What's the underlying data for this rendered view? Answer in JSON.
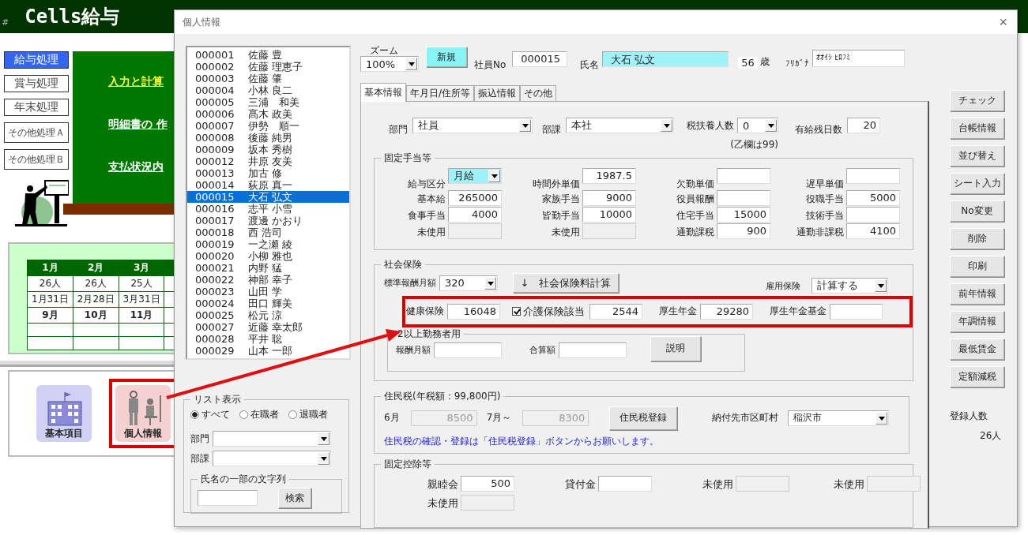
{
  "background_app": {
    "title": "Cells給与",
    "corner_mark": "#",
    "menu": [
      {
        "label": "給与処理",
        "selected": true
      },
      {
        "label": "賞与処理",
        "selected": false
      },
      {
        "label": "年末処理",
        "selected": false
      },
      {
        "label": "その他処理Ａ",
        "selected": false
      },
      {
        "label": "その他処理Ｂ",
        "selected": false
      }
    ],
    "links": [
      {
        "label": "入力と計算",
        "highlighted": true
      },
      {
        "label": "明細書の 作",
        "highlighted": false
      },
      {
        "label": "支払状況内",
        "highlighted": false
      }
    ],
    "calendar": {
      "headers": [
        "1月",
        "2月",
        "3月"
      ],
      "rows": [
        {
          "kind": "count",
          "cells": [
            "26人",
            "26人",
            "25人"
          ]
        },
        {
          "kind": "date",
          "cells": [
            "1月31日",
            "2月28日",
            "3月31日"
          ]
        },
        {
          "kind": "month",
          "cells": [
            "9月",
            "10月",
            "11月"
          ]
        }
      ]
    },
    "icons": [
      {
        "label": "基本項目",
        "kind": "building",
        "highlighted": false
      },
      {
        "label": "個人情報",
        "kind": "people",
        "highlighted": true
      }
    ]
  },
  "dialog": {
    "title": "個人情報",
    "close": "×",
    "employees": [
      {
        "id": "000001",
        "name": "佐藤 豊",
        "selected": false
      },
      {
        "id": "000002",
        "name": "佐藤 理恵子",
        "selected": false
      },
      {
        "id": "000003",
        "name": "佐藤 肇",
        "selected": false
      },
      {
        "id": "000004",
        "name": "小林 良二",
        "selected": false
      },
      {
        "id": "000005",
        "name": "三浦　和美",
        "selected": false
      },
      {
        "id": "000006",
        "name": "髙木 政美",
        "selected": false
      },
      {
        "id": "000007",
        "name": "伊勢　順一",
        "selected": false
      },
      {
        "id": "000008",
        "name": "後藤 純男",
        "selected": false
      },
      {
        "id": "000009",
        "name": "坂本 秀樹",
        "selected": false
      },
      {
        "id": "000012",
        "name": "井原 友美",
        "selected": false
      },
      {
        "id": "000013",
        "name": "加古 修",
        "selected": false
      },
      {
        "id": "000014",
        "name": "荻原 真一",
        "selected": false
      },
      {
        "id": "000015",
        "name": "大石 弘文",
        "selected": true
      },
      {
        "id": "000016",
        "name": "志平 小雪",
        "selected": false
      },
      {
        "id": "000017",
        "name": "渡邊 かおり",
        "selected": false
      },
      {
        "id": "000018",
        "name": "西 浩司",
        "selected": false
      },
      {
        "id": "000019",
        "name": "一之瀬 綾",
        "selected": false
      },
      {
        "id": "000020",
        "name": "小柳 雅也",
        "selected": false
      },
      {
        "id": "000021",
        "name": "内野 猛",
        "selected": false
      },
      {
        "id": "000022",
        "name": "神部 幸子",
        "selected": false
      },
      {
        "id": "000023",
        "name": "山田 学",
        "selected": false
      },
      {
        "id": "000024",
        "name": "田口 輝美",
        "selected": false
      },
      {
        "id": "000025",
        "name": "松元 涼",
        "selected": false
      },
      {
        "id": "000027",
        "name": "近藤 幸太郎",
        "selected": false
      },
      {
        "id": "000028",
        "name": "平井 聡",
        "selected": false
      },
      {
        "id": "000029",
        "name": "山本 一郎",
        "selected": false
      }
    ],
    "list_filter": {
      "title": "リスト表示",
      "options": [
        {
          "label": "すべて",
          "selected": true
        },
        {
          "label": "在職者",
          "selected": false
        },
        {
          "label": "退職者",
          "selected": false
        }
      ],
      "combos": [
        {
          "label": "部門"
        },
        {
          "label": "部課"
        }
      ],
      "search": {
        "title": "氏名の一部の文字列",
        "button": "検索"
      }
    },
    "zoom": {
      "label": "ズーム",
      "value": "100%"
    },
    "new_button": "新規",
    "employee_no": {
      "label": "社員No",
      "value": "000015"
    },
    "name": {
      "label": "氏名",
      "value": "大石 弘文"
    },
    "age": {
      "value": "56",
      "unit": "歳"
    },
    "kana": {
      "label": "ﾌﾘｶﾞﾅ",
      "value": "ｵｵｲｼ ﾋﾛﾌﾐ"
    },
    "tabs": [
      {
        "label": "基本情報",
        "selected": true
      },
      {
        "label": "年月日/住所等",
        "selected": false
      },
      {
        "label": "振込情報",
        "selected": false
      },
      {
        "label": "その他",
        "selected": false
      }
    ],
    "basic": {
      "department": {
        "label": "部門",
        "value": "社員"
      },
      "section": {
        "label": "部課",
        "value": "本社"
      },
      "dependents": {
        "label": "税扶養人数",
        "value": "0",
        "note": "(乙欄は99)"
      },
      "paid_leave": {
        "label": "有給残日数",
        "value": "20"
      },
      "allowances": {
        "title": "固定手当等",
        "items": [
          {
            "label": "給与区分",
            "kind": "combo",
            "value": "月給",
            "disabled": false,
            "highlighted": true
          },
          {
            "label": "時間外単価",
            "kind": "field",
            "value": "1987.5",
            "disabled": false,
            "highlighted": false
          },
          {
            "label": "欠勤単価",
            "kind": "field",
            "disabled": false,
            "highlighted": false
          },
          {
            "label": "遅早単価",
            "kind": "field",
            "disabled": false,
            "highlighted": false
          },
          {
            "label": "基本給",
            "kind": "field",
            "value": "265000",
            "disabled": false,
            "highlighted": false
          },
          {
            "label": "家族手当",
            "kind": "field",
            "value": "9000",
            "disabled": false,
            "highlighted": false
          },
          {
            "label": "役員報酬",
            "kind": "field",
            "disabled": false,
            "highlighted": false
          },
          {
            "label": "役職手当",
            "kind": "field",
            "value": "5000",
            "disabled": false,
            "highlighted": false
          },
          {
            "label": "食事手当",
            "kind": "field",
            "value": "4000",
            "disabled": false,
            "highlighted": false
          },
          {
            "label": "皆勤手当",
            "kind": "field",
            "value": "10000",
            "disabled": false,
            "highlighted": false
          },
          {
            "label": "住宅手当",
            "kind": "field",
            "value": "15000",
            "disabled": false,
            "highlighted": false
          },
          {
            "label": "技術手当",
            "kind": "field",
            "disabled": false,
            "highlighted": false
          },
          {
            "label": "未使用",
            "kind": "field",
            "disabled": true,
            "highlighted": false
          },
          {
            "label": "未使用",
            "kind": "field",
            "disabled": true,
            "highlighted": false
          },
          {
            "label": "通勤課税",
            "kind": "field",
            "value": "900",
            "disabled": false,
            "highlighted": false
          },
          {
            "label": "通勤非課税",
            "kind": "field",
            "value": "4100",
            "disabled": false,
            "highlighted": false
          }
        ]
      },
      "social": {
        "title": "社会保険",
        "standard": {
          "label": "標準報酬月額",
          "value": "320"
        },
        "calc_button": "↓　社会保険料計算",
        "employment": {
          "label": "雇用保険",
          "value": "計算する"
        },
        "premiums": {
          "highlighted": true,
          "items": [
            {
              "label": "健康保険",
              "kind": "field",
              "value": "16048"
            },
            {
              "label": "介護保険該当",
              "kind": "check",
              "checked": true,
              "value": "2544"
            },
            {
              "label": "厚生年金",
              "kind": "field",
              "value": "29280"
            },
            {
              "label": "厚生年金基金",
              "kind": "field"
            }
          ]
        },
        "multi": {
          "title": "2以上勤務者用",
          "items": [
            {
              "label": "報酬月額"
            },
            {
              "label": "合算額"
            }
          ],
          "button": "説明"
        }
      },
      "resident_tax": {
        "title": "住民税(年税額：99,800円)",
        "items": [
          {
            "label": "6月",
            "value": "8500",
            "disabled": true
          },
          {
            "label": "7月～",
            "value": "8300",
            "disabled": true
          }
        ],
        "button": "住民税登録",
        "city": {
          "label": "納付先市区町村",
          "value": "稲沢市"
        },
        "note": "住民税の確認・登録は「住民税登録」ボタンからお願いします。"
      },
      "deductions": {
        "title": "固定控除等",
        "items": [
          {
            "label": "親睦会",
            "value": "500",
            "disabled": false
          },
          {
            "label": "貸付金",
            "disabled": false
          },
          {
            "label": "未使用",
            "disabled": true
          },
          {
            "label": "未使用",
            "disabled": true
          },
          {
            "label": "未使用",
            "disabled": true
          }
        ]
      }
    },
    "side_buttons": [
      "チェック",
      "台帳情報",
      "並び替え",
      "シート入力",
      "No変更",
      "削除",
      "印刷",
      "前年情報",
      "年調情報",
      "最低賃金",
      "定額減税"
    ],
    "count": {
      "label": "登録人数",
      "value": "26人"
    }
  }
}
